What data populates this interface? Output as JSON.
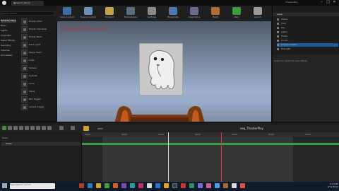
{
  "titlebar": {
    "tab_label": "Viewport_Nurse",
    "project_name": "TheaterPlay",
    "win_min": "–",
    "win_max": "□",
    "win_close": "✕"
  },
  "toolbar": {
    "buttons": [
      {
        "label": "Save Current",
        "icon": "save-icon",
        "color": "#3f6ea3"
      },
      {
        "label": "Source Control",
        "icon": "source-control-icon",
        "color": "#6d8fb3"
      },
      {
        "label": "Content",
        "icon": "content-icon",
        "color": "#c2a24a"
      },
      {
        "label": "Marketplace",
        "icon": "marketplace-icon",
        "color": "#5b6c7e"
      },
      {
        "label": "Settings",
        "icon": "settings-icon",
        "color": "#8a8a8a"
      },
      {
        "label": "Blueprints",
        "icon": "blueprints-icon",
        "color": "#4f78b0"
      },
      {
        "label": "Cinematics",
        "icon": "cinematics-icon",
        "color": "#6a6a8a"
      },
      {
        "label": "Build",
        "icon": "build-icon",
        "color": "#b36c34"
      },
      {
        "label": "Play",
        "icon": "play-icon",
        "color": "#3c9b3c"
      },
      {
        "label": "Launch",
        "icon": "launch-icon",
        "color": "#9a9a9a"
      }
    ]
  },
  "left_panel": {
    "search_placeholder": "Search Classes",
    "categories": [
      "Recently Placed",
      "Basic",
      "Lights",
      "Cinematic",
      "Visual Effects",
      "Geometry",
      "Volumes",
      "All Classes"
    ],
    "items": [
      "Empty Actor",
      "Empty Character",
      "Empty Pawn",
      "Point Light",
      "Player Start",
      "Cube",
      "Sphere",
      "Cylinder",
      "Cone",
      "Plane",
      "Box Trigger",
      "Sphere Trigger"
    ]
  },
  "viewport": {
    "overlay_text": "LIGHTING NEEDS TO BE REBUILT"
  },
  "outliner": {
    "header": "Label",
    "rows": [
      "Scene",
      "Floor",
      "Sky",
      "Lights",
      "Poster",
      "Couch",
      "SequenceActor",
      "SkyLight"
    ]
  },
  "details": {
    "message": "Select an object to view details."
  },
  "sequencer": {
    "track_header": "Track",
    "track_name": "Poster",
    "sequence_name": "seq_TheaterPlay",
    "frame_display": "0057",
    "ruler_labels": [
      "0000",
      "0025",
      "0050",
      "0075",
      "0100",
      "0125",
      "0150"
    ]
  },
  "taskbar": {
    "search_placeholder": "Type here to search",
    "time": "5:13 PM",
    "date": "9/11/2020"
  }
}
